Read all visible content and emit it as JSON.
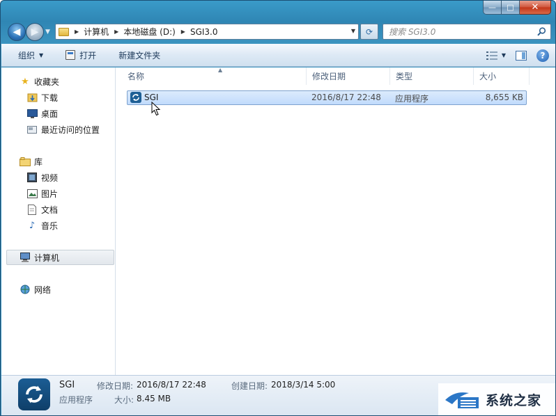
{
  "window": {
    "caption": {
      "minimize": "—",
      "maximize": "□",
      "close": "✕"
    }
  },
  "address": {
    "crumbs": [
      "计算机",
      "本地磁盘 (D:)",
      "SGI3.0"
    ],
    "search_placeholder": "搜索 SGI3.0"
  },
  "toolbar": {
    "organize": "组织",
    "open": "打开",
    "new_folder": "新建文件夹"
  },
  "nav": {
    "favorites": {
      "header": "收藏夹",
      "items": [
        "下载",
        "桌面",
        "最近访问的位置"
      ]
    },
    "libraries": {
      "header": "库",
      "items": [
        "视频",
        "图片",
        "文档",
        "音乐"
      ]
    },
    "computer": "计算机",
    "network": "网络"
  },
  "columns": {
    "name": "名称",
    "modified": "修改日期",
    "type": "类型",
    "size": "大小"
  },
  "files": [
    {
      "name": "SGI",
      "modified": "2016/8/17 22:48",
      "type": "应用程序",
      "size": "8,655 KB"
    }
  ],
  "details": {
    "name": "SGI",
    "type": "应用程序",
    "modified_label": "修改日期:",
    "modified_value": "2016/8/17 22:48",
    "created_label": "创建日期:",
    "created_value": "2018/3/14 5:00",
    "size_label": "大小:",
    "size_value": "8.45 MB"
  },
  "watermark": {
    "text": "系统之家"
  },
  "colors": {
    "accent": "#3a9bc9",
    "selection": "#c1dbfc",
    "app_icon": "#1e5f95"
  }
}
